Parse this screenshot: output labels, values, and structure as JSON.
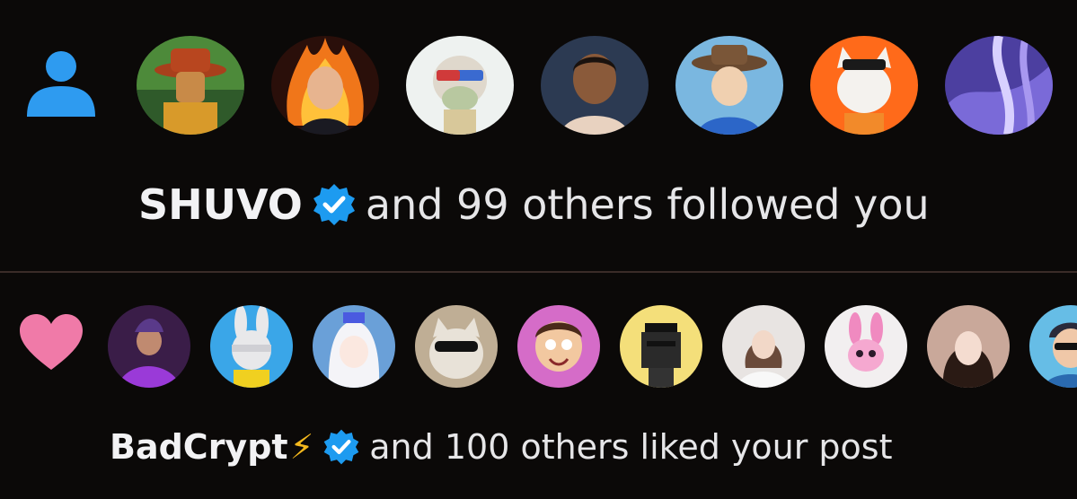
{
  "follow_notification": {
    "icon": "person-icon",
    "icon_color": "#2e9bf0",
    "actor_name": "SHUVO",
    "verified": true,
    "message": "and 99 others followed you",
    "avatars": [
      {
        "name": "avatar-hat-man",
        "bg": "#4d8a3a"
      },
      {
        "name": "avatar-fire-woman",
        "bg": "#2a0f0a"
      },
      {
        "name": "avatar-ape-nft",
        "bg": "#eef2f0"
      },
      {
        "name": "avatar-man-portrait",
        "bg": "#2c3a52"
      },
      {
        "name": "avatar-cowboy",
        "bg": "#7ab7e0"
      },
      {
        "name": "avatar-pirate-cat",
        "bg": "#ff6a1a"
      },
      {
        "name": "avatar-purple-abstract",
        "bg": "#4c3fa0"
      }
    ]
  },
  "like_notification": {
    "icon": "heart-icon",
    "icon_color": "#f07aa8",
    "actor_name": "BadCrypt",
    "actor_suffix": "⚡",
    "verified": true,
    "message": "and 100 others liked your post",
    "avatars": [
      {
        "name": "avatar-purple-hero",
        "bg": "#3a1d48"
      },
      {
        "name": "avatar-bunny-bandage",
        "bg": "#3aa6e8"
      },
      {
        "name": "avatar-anime-girl",
        "bg": "#6aa0d8"
      },
      {
        "name": "avatar-cool-cat",
        "bg": "#bfae95"
      },
      {
        "name": "avatar-cartoon-boy",
        "bg": "#d56cc8"
      },
      {
        "name": "avatar-pixel-punk",
        "bg": "#f4df7a"
      },
      {
        "name": "avatar-woman-white",
        "bg": "#e8e4e2"
      },
      {
        "name": "avatar-pink-bunny",
        "bg": "#f2eff0"
      },
      {
        "name": "avatar-woman-dark",
        "bg": "#c9a89a"
      },
      {
        "name": "avatar-man-sunglasses",
        "bg": "#66bde6"
      }
    ]
  },
  "verified_badge_color": "#1d9bf0"
}
